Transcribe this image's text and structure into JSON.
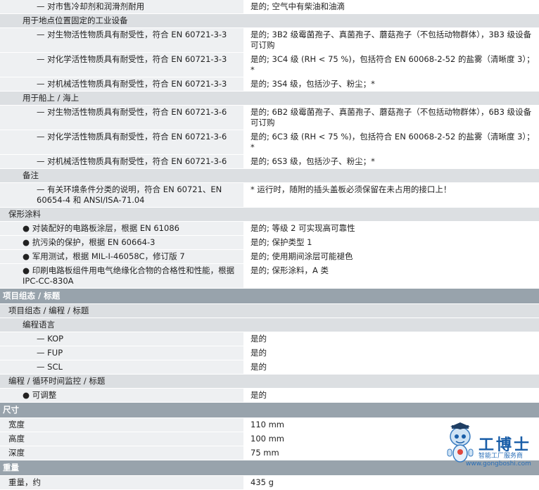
{
  "rows": [
    {
      "t": "pair",
      "cls": "lv2",
      "k": "— 对市售冷却剂和润滑剂耐用",
      "v": "是的; 空气中有柴油和油滴"
    },
    {
      "t": "sub2",
      "k": "用于地点位置固定的工业设备"
    },
    {
      "t": "pair",
      "cls": "lv2",
      "k": "— 对生物活性物质具有耐受性，符合 EN 60721-3-3",
      "v": "是的; 3B2 级霉菌孢子、真菌孢子、蘑菇孢子（不包括动物群体），3B3 级设备可订购"
    },
    {
      "t": "pair",
      "cls": "lv2",
      "k": "— 对化学活性物质具有耐受性，符合 EN 60721-3-3",
      "v": "是的; 3C4 级 (RH < 75 %)，包括符合 EN 60068-2-52 的盐雾（清晰度 3）；*"
    },
    {
      "t": "pair",
      "cls": "lv2",
      "k": "— 对机械活性物质具有耐受性，符合 EN 60721-3-3",
      "v": "是的; 3S4 级，包括沙子、粉尘；*"
    },
    {
      "t": "sub2",
      "k": "用于船上 / 海上"
    },
    {
      "t": "pair",
      "cls": "lv2",
      "k": "— 对生物活性物质具有耐受性，符合 EN 60721-3-6",
      "v": "是的; 6B2 级霉菌孢子、真菌孢子、蘑菇孢子（不包括动物群体），6B3 级设备可订购"
    },
    {
      "t": "pair",
      "cls": "lv2",
      "k": "— 对化学活性物质具有耐受性，符合 EN 60721-3-6",
      "v": "是的; 6C3 级 (RH < 75 %)，包括符合 EN 60068-2-52 的盐雾（清晰度 3）；*"
    },
    {
      "t": "pair",
      "cls": "lv2",
      "k": "— 对机械活性物质具有耐受性，符合 EN 60721-3-6",
      "v": "是的; 6S3 级，包括沙子、粉尘；*"
    },
    {
      "t": "sub2",
      "k": "备注"
    },
    {
      "t": "pair",
      "cls": "lv2",
      "k": "— 有关环境条件分类的说明，符合 EN 60721、EN 60654-4 和 ANSI/ISA-71.04",
      "v": "* 运行时，随附的插头盖板必须保留在未占用的接口上！"
    },
    {
      "t": "sub1",
      "k": "保形涂料"
    },
    {
      "t": "pair",
      "cls": "bullet",
      "k": "● 对装配好的电路板涂层，根据 EN 61086",
      "v": "是的; 等级 2 可实现高可靠性"
    },
    {
      "t": "pair",
      "cls": "bullet",
      "k": "● 抗污染的保护，根据 EN 60664-3",
      "v": "是的; 保护类型 1"
    },
    {
      "t": "pair",
      "cls": "bullet",
      "k": "● 军用测试，根据 MIL-I-46058C，修订版 7",
      "v": "是的; 使用期间涂层可能褪色"
    },
    {
      "t": "pair",
      "cls": "bullet",
      "k": "● 印刷电路板组件用电气绝缘化合物的合格性和性能，根据 IPC-CC-830A",
      "v": "是的; 保形涂料，A 类"
    },
    {
      "t": "main",
      "k": "项目组态 / 标题"
    },
    {
      "t": "sub1",
      "k": "项目组态 / 编程 / 标题"
    },
    {
      "t": "sub2",
      "k": "编程语言"
    },
    {
      "t": "pair",
      "cls": "lv2",
      "k": "— KOP",
      "v": "是的"
    },
    {
      "t": "pair",
      "cls": "lv2",
      "k": "— FUP",
      "v": "是的"
    },
    {
      "t": "pair",
      "cls": "lv2",
      "k": "— SCL",
      "v": "是的"
    },
    {
      "t": "sub1",
      "k": "编程 / 循环时间监控 / 标题"
    },
    {
      "t": "pair",
      "cls": "bullet",
      "k": "● 可调整",
      "v": "是的"
    },
    {
      "t": "main",
      "k": "尺寸"
    },
    {
      "t": "pair",
      "cls": "simple",
      "k": "宽度",
      "v": "110 mm"
    },
    {
      "t": "pair",
      "cls": "simple",
      "k": "高度",
      "v": "100 mm"
    },
    {
      "t": "pair",
      "cls": "simple",
      "k": "深度",
      "v": "75 mm"
    },
    {
      "t": "main",
      "k": "重量"
    },
    {
      "t": "pair",
      "cls": "simple",
      "k": "重量，约",
      "v": "435 g"
    }
  ],
  "logo": {
    "brand": "工博士",
    "tagline": "智能工厂服务商",
    "url": "www.gongboshi.com",
    "mark": "®"
  },
  "colors": {
    "main_header": "#98a3ac",
    "sub_header": "#dcdfe2",
    "label_cell": "#eef0f2",
    "brand_blue": "#1a5ea8"
  }
}
